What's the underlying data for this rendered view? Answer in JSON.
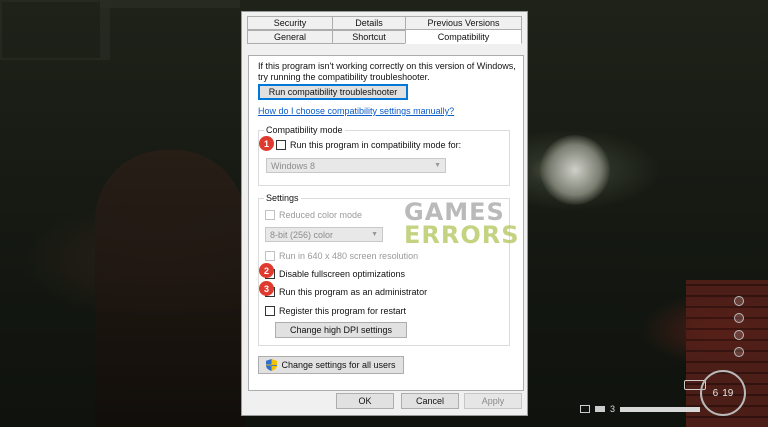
{
  "tabs_row1": [
    "Security",
    "Details",
    "Previous Versions"
  ],
  "tabs_row2": [
    "General",
    "Shortcut",
    "Compatibility"
  ],
  "intro_text": "If this program isn't working correctly on this version of Windows, try running the compatibility troubleshooter.",
  "troubleshooter_button": "Run compatibility troubleshooter",
  "manual_link": "How do I choose compatibility settings manually?",
  "compat_mode": {
    "title": "Compatibility mode",
    "checkbox_label": "Run this program in compatibility mode for:",
    "os_value": "Windows 8"
  },
  "settings": {
    "title": "Settings",
    "reduced_color": "Reduced color mode",
    "color_value": "8-bit (256) color",
    "resolution": "Run in 640 x 480 screen resolution",
    "disable_fullscreen": "Disable fullscreen optimizations",
    "run_admin": "Run this program as an administrator",
    "register_restart": "Register this program for restart",
    "dpi_button": "Change high DPI settings"
  },
  "all_users_button": "Change settings for all users",
  "footer": {
    "ok": "OK",
    "cancel": "Cancel",
    "apply": "Apply"
  },
  "badges": [
    "1",
    "2",
    "3"
  ],
  "watermark": {
    "line1": "GAMES",
    "line2": "ERRORS"
  },
  "hud": {
    "ammo_loaded": "6",
    "ammo_reserve": "19",
    "item_count": "3",
    "stamina_fraction": 1.0
  },
  "colors": {
    "badge_red": "#e03a2f",
    "link_blue": "#0a5cc8",
    "focus_blue": "#0078d7",
    "watermark_green": "#b0c458"
  }
}
